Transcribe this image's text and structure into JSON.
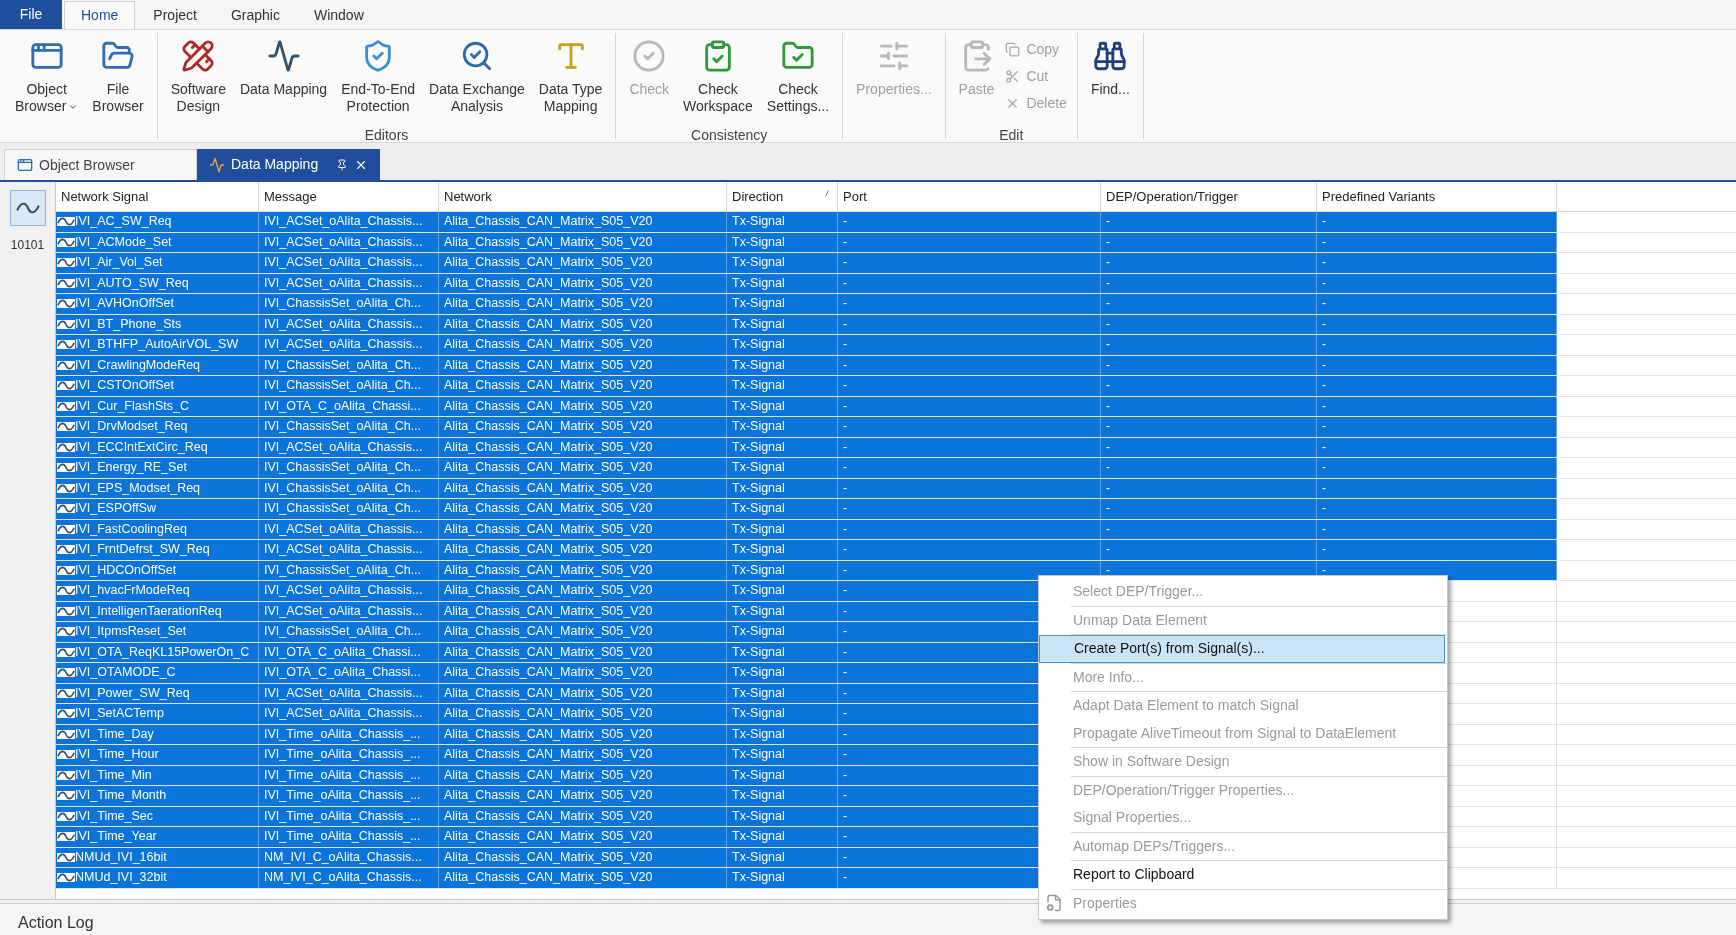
{
  "menu_tabs": [
    {
      "label": "File",
      "kind": "file",
      "selected": false
    },
    {
      "label": "Home",
      "kind": "tab",
      "selected": true
    },
    {
      "label": "Project",
      "kind": "tab",
      "selected": false
    },
    {
      "label": "Graphic",
      "kind": "tab",
      "selected": false
    },
    {
      "label": "Window",
      "kind": "tab",
      "selected": false
    }
  ],
  "ribbon": {
    "groups": [
      {
        "items": [
          {
            "label": "Object\nBrowser",
            "kind": "large",
            "disabled": false,
            "dropdown": true
          },
          {
            "label": "File\nBrowser",
            "kind": "large",
            "disabled": false,
            "dropdown": false
          }
        ]
      },
      {
        "label": "Editors",
        "items": [
          {
            "label": "Software\nDesign",
            "kind": "large",
            "disabled": false,
            "dropdown": false
          },
          {
            "label": "Data Mapping",
            "kind": "large",
            "disabled": false,
            "dropdown": false
          },
          {
            "label": "End-To-End\nProtection",
            "kind": "large",
            "disabled": false,
            "dropdown": false
          },
          {
            "label": "Data Exchange\nAnalysis",
            "kind": "large",
            "disabled": false,
            "dropdown": false
          },
          {
            "label": "Data Type\nMapping",
            "kind": "large",
            "disabled": false,
            "dropdown": false
          }
        ]
      },
      {
        "label": "Consistency",
        "items": [
          {
            "label": "Check",
            "kind": "large",
            "disabled": true,
            "dropdown": false
          },
          {
            "label": "Check\nWorkspace",
            "kind": "large",
            "disabled": false,
            "dropdown": false
          },
          {
            "label": "Check\nSettings...",
            "kind": "large",
            "disabled": false,
            "dropdown": false
          }
        ]
      },
      {
        "items": [
          {
            "label": "Properties...",
            "kind": "large",
            "disabled": true,
            "dropdown": false
          }
        ]
      },
      {
        "label": "Edit",
        "items": [
          {
            "label": "Paste",
            "kind": "large",
            "disabled": true,
            "dropdown": false
          },
          {
            "label": "Copy",
            "kind": "small",
            "disabled": true
          },
          {
            "label": "Cut",
            "kind": "small",
            "disabled": true
          },
          {
            "label": "Delete",
            "kind": "small",
            "disabled": true
          }
        ]
      },
      {
        "items": [
          {
            "label": "Find...",
            "kind": "large",
            "disabled": false,
            "dropdown": false
          }
        ]
      }
    ]
  },
  "doc_tabs": [
    {
      "label": "Object Browser",
      "selected": false
    },
    {
      "label": "Data Mapping",
      "selected": true
    }
  ],
  "side_strip": {
    "label": "10101",
    "wave_selected": true
  },
  "table": {
    "columns": [
      "Network Signal",
      "Message",
      "Network",
      "Direction",
      "Port",
      "DEP/Operation/Trigger",
      "Predefined Variants"
    ],
    "rows": [
      {
        "signal": "IVI_AC_SW_Req",
        "message": "IVI_ACSet_oAlita_Chassis...",
        "network": "Alita_Chassis_CAN_Matrix_S05_V20",
        "direction": "Tx-Signal",
        "port": "-",
        "dep": "-",
        "variants": "-",
        "selected": true
      },
      {
        "signal": "IVI_ACMode_Set",
        "message": "IVI_ACSet_oAlita_Chassis...",
        "network": "Alita_Chassis_CAN_Matrix_S05_V20",
        "direction": "Tx-Signal",
        "port": "-",
        "dep": "-",
        "variants": "-",
        "selected": true
      },
      {
        "signal": "IVI_Air_Vol_Set",
        "message": "IVI_ACSet_oAlita_Chassis...",
        "network": "Alita_Chassis_CAN_Matrix_S05_V20",
        "direction": "Tx-Signal",
        "port": "-",
        "dep": "-",
        "variants": "-",
        "selected": true
      },
      {
        "signal": "IVI_AUTO_SW_Req",
        "message": "IVI_ACSet_oAlita_Chassis...",
        "network": "Alita_Chassis_CAN_Matrix_S05_V20",
        "direction": "Tx-Signal",
        "port": "-",
        "dep": "-",
        "variants": "-",
        "selected": true
      },
      {
        "signal": "IVI_AVHOnOffSet",
        "message": "IVI_ChassisSet_oAlita_Ch...",
        "network": "Alita_Chassis_CAN_Matrix_S05_V20",
        "direction": "Tx-Signal",
        "port": "-",
        "dep": "-",
        "variants": "-",
        "selected": true
      },
      {
        "signal": "IVI_BT_Phone_Sts",
        "message": "IVI_ACSet_oAlita_Chassis...",
        "network": "Alita_Chassis_CAN_Matrix_S05_V20",
        "direction": "Tx-Signal",
        "port": "-",
        "dep": "-",
        "variants": "-",
        "selected": true
      },
      {
        "signal": "IVI_BTHFP_AutoAirVOL_SW",
        "message": "IVI_ACSet_oAlita_Chassis...",
        "network": "Alita_Chassis_CAN_Matrix_S05_V20",
        "direction": "Tx-Signal",
        "port": "-",
        "dep": "-",
        "variants": "-",
        "selected": true
      },
      {
        "signal": "IVI_CrawlingModeReq",
        "message": "IVI_ChassisSet_oAlita_Ch...",
        "network": "Alita_Chassis_CAN_Matrix_S05_V20",
        "direction": "Tx-Signal",
        "port": "-",
        "dep": "-",
        "variants": "-",
        "selected": true
      },
      {
        "signal": "IVI_CSTOnOffSet",
        "message": "IVI_ChassisSet_oAlita_Ch...",
        "network": "Alita_Chassis_CAN_Matrix_S05_V20",
        "direction": "Tx-Signal",
        "port": "-",
        "dep": "-",
        "variants": "-",
        "selected": true
      },
      {
        "signal": "IVI_Cur_FlashSts_C",
        "message": "IVI_OTA_C_oAlita_Chassi...",
        "network": "Alita_Chassis_CAN_Matrix_S05_V20",
        "direction": "Tx-Signal",
        "port": "-",
        "dep": "-",
        "variants": "-",
        "selected": true
      },
      {
        "signal": "IVI_DrvModset_Req",
        "message": "IVI_ChassisSet_oAlita_Ch...",
        "network": "Alita_Chassis_CAN_Matrix_S05_V20",
        "direction": "Tx-Signal",
        "port": "-",
        "dep": "-",
        "variants": "-",
        "selected": true
      },
      {
        "signal": "IVI_ECCIntExtCirc_Req",
        "message": "IVI_ACSet_oAlita_Chassis...",
        "network": "Alita_Chassis_CAN_Matrix_S05_V20",
        "direction": "Tx-Signal",
        "port": "-",
        "dep": "-",
        "variants": "-",
        "selected": true
      },
      {
        "signal": "IVI_Energy_RE_Set",
        "message": "IVI_ChassisSet_oAlita_Ch...",
        "network": "Alita_Chassis_CAN_Matrix_S05_V20",
        "direction": "Tx-Signal",
        "port": "-",
        "dep": "-",
        "variants": "-",
        "selected": true
      },
      {
        "signal": "IVI_EPS_Modset_Req",
        "message": "IVI_ChassisSet_oAlita_Ch...",
        "network": "Alita_Chassis_CAN_Matrix_S05_V20",
        "direction": "Tx-Signal",
        "port": "-",
        "dep": "-",
        "variants": "-",
        "selected": true
      },
      {
        "signal": "IVI_ESPOffSw",
        "message": "IVI_ChassisSet_oAlita_Ch...",
        "network": "Alita_Chassis_CAN_Matrix_S05_V20",
        "direction": "Tx-Signal",
        "port": "-",
        "dep": "-",
        "variants": "-",
        "selected": true
      },
      {
        "signal": "IVI_FastCoolingReq",
        "message": "IVI_ACSet_oAlita_Chassis...",
        "network": "Alita_Chassis_CAN_Matrix_S05_V20",
        "direction": "Tx-Signal",
        "port": "-",
        "dep": "-",
        "variants": "-",
        "selected": true
      },
      {
        "signal": "IVI_FrntDefrst_SW_Req",
        "message": "IVI_ACSet_oAlita_Chassis...",
        "network": "Alita_Chassis_CAN_Matrix_S05_V20",
        "direction": "Tx-Signal",
        "port": "-",
        "dep": "-",
        "variants": "-",
        "selected": true
      },
      {
        "signal": "IVI_HDCOnOffSet",
        "message": "IVI_ChassisSet_oAlita_Ch...",
        "network": "Alita_Chassis_CAN_Matrix_S05_V20",
        "direction": "Tx-Signal",
        "port": "-",
        "dep": "-",
        "variants": "-",
        "selected": true
      },
      {
        "signal": "IVI_hvacFrModeReq",
        "message": "IVI_ACSet_oAlita_Chassis...",
        "network": "Alita_Chassis_CAN_Matrix_S05_V20",
        "direction": "Tx-Signal",
        "port": "-",
        "selected": true
      },
      {
        "signal": "IVI_IntelligenTaerationReq",
        "message": "IVI_ACSet_oAlita_Chassis...",
        "network": "Alita_Chassis_CAN_Matrix_S05_V20",
        "direction": "Tx-Signal",
        "port": "-",
        "selected": true
      },
      {
        "signal": "IVI_ItpmsReset_Set",
        "message": "IVI_ChassisSet_oAlita_Ch...",
        "network": "Alita_Chassis_CAN_Matrix_S05_V20",
        "direction": "Tx-Signal",
        "port": "-",
        "selected": true
      },
      {
        "signal": "IVI_OTA_ReqKL15PowerOn_C",
        "message": "IVI_OTA_C_oAlita_Chassi...",
        "network": "Alita_Chassis_CAN_Matrix_S05_V20",
        "direction": "Tx-Signal",
        "port": "-",
        "selected": true
      },
      {
        "signal": "IVI_OTAMODE_C",
        "message": "IVI_OTA_C_oAlita_Chassi...",
        "network": "Alita_Chassis_CAN_Matrix_S05_V20",
        "direction": "Tx-Signal",
        "port": "-",
        "selected": true
      },
      {
        "signal": "IVI_Power_SW_Req",
        "message": "IVI_ACSet_oAlita_Chassis...",
        "network": "Alita_Chassis_CAN_Matrix_S05_V20",
        "direction": "Tx-Signal",
        "port": "-",
        "selected": true
      },
      {
        "signal": "IVI_SetACTemp",
        "message": "IVI_ACSet_oAlita_Chassis...",
        "network": "Alita_Chassis_CAN_Matrix_S05_V20",
        "direction": "Tx-Signal",
        "port": "-",
        "selected": true
      },
      {
        "signal": "IVI_Time_Day",
        "message": "IVI_Time_oAlita_Chassis_...",
        "network": "Alita_Chassis_CAN_Matrix_S05_V20",
        "direction": "Tx-Signal",
        "port": "-",
        "selected": true
      },
      {
        "signal": "IVI_Time_Hour",
        "message": "IVI_Time_oAlita_Chassis_...",
        "network": "Alita_Chassis_CAN_Matrix_S05_V20",
        "direction": "Tx-Signal",
        "port": "-",
        "selected": true
      },
      {
        "signal": "IVI_Time_Min",
        "message": "IVI_Time_oAlita_Chassis_...",
        "network": "Alita_Chassis_CAN_Matrix_S05_V20",
        "direction": "Tx-Signal",
        "port": "-",
        "selected": true
      },
      {
        "signal": "IVI_Time_Month",
        "message": "IVI_Time_oAlita_Chassis_...",
        "network": "Alita_Chassis_CAN_Matrix_S05_V20",
        "direction": "Tx-Signal",
        "port": "-",
        "selected": true
      },
      {
        "signal": "IVI_Time_Sec",
        "message": "IVI_Time_oAlita_Chassis_...",
        "network": "Alita_Chassis_CAN_Matrix_S05_V20",
        "direction": "Tx-Signal",
        "port": "-",
        "selected": true
      },
      {
        "signal": "IVI_Time_Year",
        "message": "IVI_Time_oAlita_Chassis_...",
        "network": "Alita_Chassis_CAN_Matrix_S05_V20",
        "direction": "Tx-Signal",
        "port": "-",
        "selected": true
      },
      {
        "signal": "NMUd_IVI_16bit",
        "message": "NM_IVI_C_oAlita_Chassis...",
        "network": "Alita_Chassis_CAN_Matrix_S05_V20",
        "direction": "Tx-Signal",
        "port": "-",
        "selected": true
      },
      {
        "signal": "NMUd_IVI_32bit",
        "message": "NM_IVI_C_oAlita_Chassis...",
        "network": "Alita_Chassis_CAN_Matrix_S05_V20",
        "direction": "Tx-Signal",
        "port": "-",
        "selected": true
      }
    ]
  },
  "context_menu": {
    "groups": [
      [
        {
          "label": "Select DEP/Trigger...",
          "disabled": true,
          "selected": false
        }
      ],
      [
        {
          "label": "Unmap Data Element",
          "disabled": true,
          "selected": false
        }
      ],
      [
        {
          "label": "Create Port(s) from Signal(s)...",
          "disabled": false,
          "selected": true
        }
      ],
      [
        {
          "label": "More Info...",
          "disabled": true,
          "selected": false
        }
      ],
      [
        {
          "label": "Adapt Data Element to match Signal",
          "disabled": true,
          "selected": false
        },
        {
          "label": "Propagate AliveTimeout from Signal to DataElement",
          "disabled": true,
          "selected": false
        }
      ],
      [
        {
          "label": "Show in Software Design",
          "disabled": true,
          "selected": false
        }
      ],
      [
        {
          "label": "DEP/Operation/Trigger Properties...",
          "disabled": true,
          "selected": false
        },
        {
          "label": "Signal Properties...",
          "disabled": true,
          "selected": false
        }
      ],
      [
        {
          "label": "Automap DEPs/Triggers...",
          "disabled": true,
          "selected": false
        }
      ],
      [
        {
          "label": "Report to Clipboard",
          "disabled": false,
          "selected": false
        }
      ],
      [
        {
          "label": "Properties",
          "disabled": true,
          "selected": false,
          "icon": true
        }
      ]
    ]
  },
  "action_log": {
    "title": "Action Log"
  }
}
